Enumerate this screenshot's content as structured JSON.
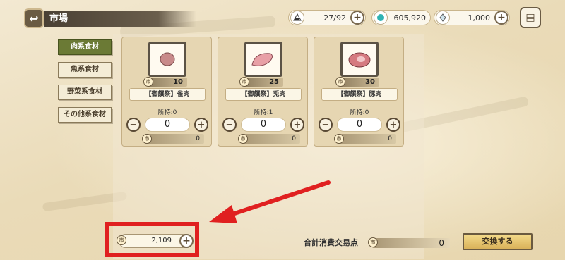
{
  "header": {
    "title": "市場"
  },
  "resources": [
    {
      "icon": "onigiri-icon",
      "value": "27/92"
    },
    {
      "icon": "gem-icon",
      "value": "605,920"
    },
    {
      "icon": "crystal-icon",
      "value": "1,000"
    }
  ],
  "tabs": [
    {
      "label": "肉系食材",
      "active": true
    },
    {
      "label": "魚系食材",
      "active": false
    },
    {
      "label": "野菜系食材",
      "active": false
    },
    {
      "label": "その他系食材",
      "active": false
    }
  ],
  "items": [
    {
      "name": "【御饌祭】雀肉",
      "price": "10",
      "owned": "所持:0",
      "qty": "0",
      "cost": "0",
      "meat_color": "#c88a8a"
    },
    {
      "name": "【御饌祭】兎肉",
      "price": "25",
      "owned": "所持:1",
      "qty": "0",
      "cost": "0",
      "meat_color": "#e8a0a6"
    },
    {
      "name": "【御饌祭】豚肉",
      "price": "30",
      "owned": "所持:0",
      "qty": "0",
      "cost": "0",
      "meat_color": "#d57a80"
    }
  ],
  "balance": "2,109",
  "total": {
    "label": "合計消費交易点",
    "value": "0"
  },
  "exchange_label": "交換する",
  "colors": {
    "highlight": "#e02020",
    "tab_active": "#6b7a35"
  }
}
